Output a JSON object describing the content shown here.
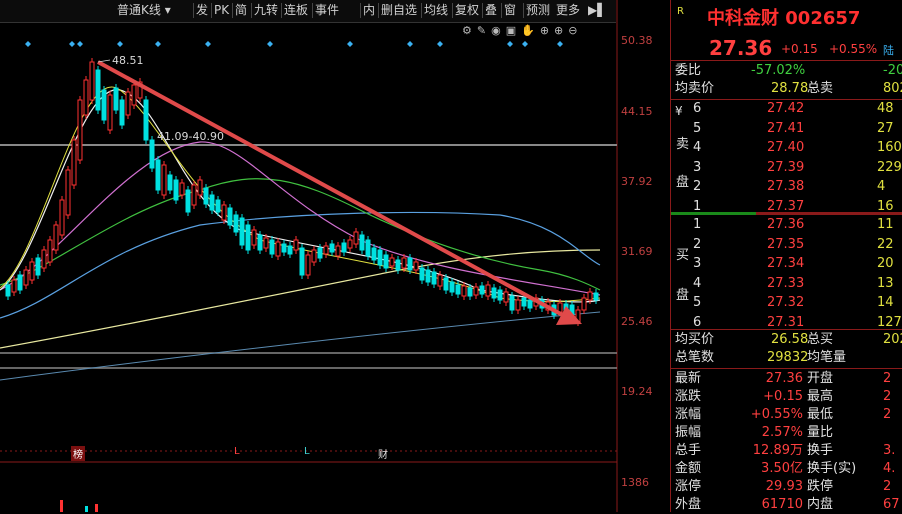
{
  "toolbar": {
    "chart_type": "普通K线",
    "buttons": [
      "发",
      "PK",
      "简",
      "九转",
      "连板",
      "事件",
      "内",
      "删自选",
      "均线",
      "复权",
      "叠",
      "窗",
      "预测",
      "更多"
    ]
  },
  "price_axis": [
    "50.38",
    "44.15",
    "37.92",
    "31.69",
    "25.46",
    "19.24"
  ],
  "volume_axis": "1386",
  "annotations": {
    "high": "48.51",
    "range": "41.09-40.90"
  },
  "event_markers": [
    "榜",
    "L",
    "L",
    "财"
  ],
  "stock": {
    "name": "中科金财",
    "code": "002657",
    "price": "27.36",
    "change": "+0.15",
    "pct": "+0.55%",
    "tag": "陆"
  },
  "weibi": {
    "label": "委比",
    "value": "-57.02%",
    "right": "-20"
  },
  "avg_sell": {
    "label": "均卖价",
    "value": "28.78",
    "right_label": "总卖",
    "right": "802"
  },
  "sell_label": "卖盘",
  "buy_label": "买盘",
  "asks": [
    {
      "lvl": "6",
      "price": "27.42",
      "vol": "48"
    },
    {
      "lvl": "5",
      "price": "27.41",
      "vol": "27"
    },
    {
      "lvl": "4",
      "price": "27.40",
      "vol": "160"
    },
    {
      "lvl": "3",
      "price": "27.39",
      "vol": "229"
    },
    {
      "lvl": "2",
      "price": "27.38",
      "vol": "4"
    },
    {
      "lvl": "1",
      "price": "27.37",
      "vol": "16"
    }
  ],
  "bids": [
    {
      "lvl": "1",
      "price": "27.36",
      "vol": "11"
    },
    {
      "lvl": "2",
      "price": "27.35",
      "vol": "22"
    },
    {
      "lvl": "3",
      "price": "27.34",
      "vol": "20"
    },
    {
      "lvl": "4",
      "price": "27.33",
      "vol": "13"
    },
    {
      "lvl": "5",
      "price": "27.32",
      "vol": "14"
    },
    {
      "lvl": "6",
      "price": "27.31",
      "vol": "127"
    }
  ],
  "avg_buy": {
    "label": "均买价",
    "value": "26.58",
    "right_label": "总买",
    "right": "202"
  },
  "total": {
    "label": "总笔数",
    "value": "29832",
    "right_label": "均笔量",
    "right": ""
  },
  "stats": [
    {
      "l": "最新",
      "v": "27.36",
      "rl": "开盘",
      "rv": "2"
    },
    {
      "l": "涨跌",
      "v": "+0.15",
      "rl": "最高",
      "rv": "2"
    },
    {
      "l": "涨幅",
      "v": "+0.55%",
      "rl": "最低",
      "rv": "2"
    },
    {
      "l": "振幅",
      "v": "2.57%",
      "rl": "量比",
      "rv": ""
    },
    {
      "l": "总手",
      "v": "12.89万",
      "rl": "换手",
      "rv": "3."
    },
    {
      "l": "金额",
      "v": "3.50亿",
      "rl": "换手(实)",
      "rv": "4."
    },
    {
      "l": "涨停",
      "v": "29.93",
      "rl": "跌停",
      "rv": "2"
    },
    {
      "l": "外盘",
      "v": "61710",
      "rl": "内盘",
      "rv": "67"
    }
  ],
  "colors": {
    "up": "#ff3232",
    "down": "#00e0e0",
    "accent": "#ff4040"
  }
}
